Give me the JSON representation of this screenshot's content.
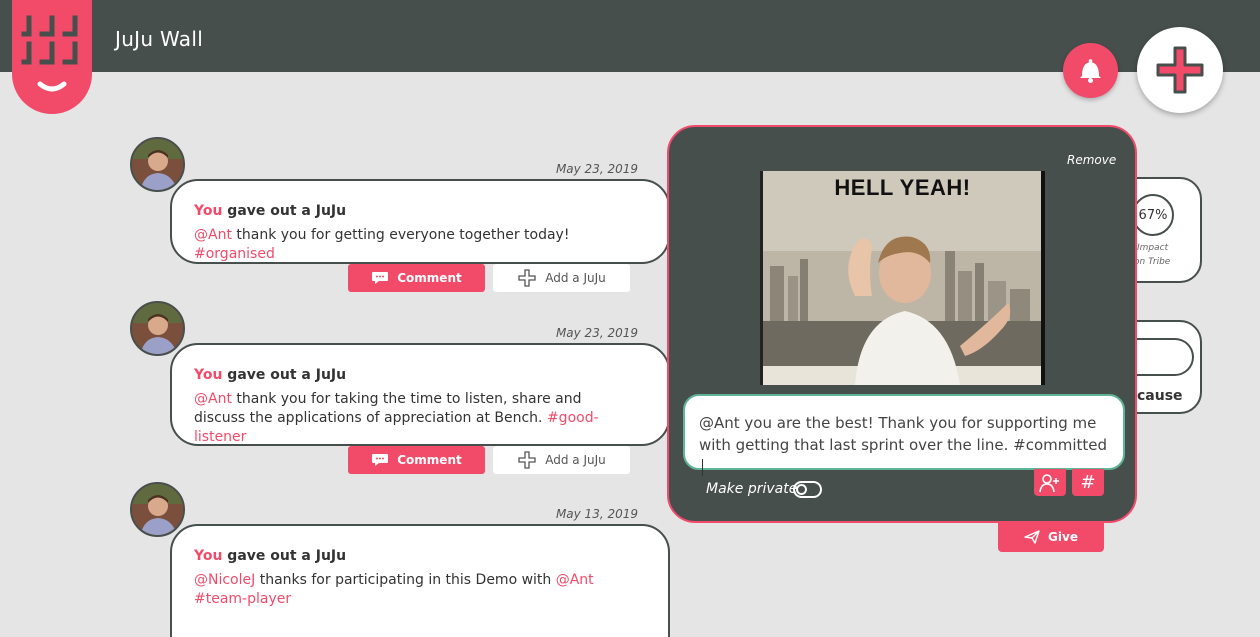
{
  "header": {
    "app_title": "JuJu Wall"
  },
  "colors": {
    "brand_pink": "#f24b6a",
    "topbar_dark": "#474f4d",
    "background": "#e5e5e5",
    "message_border_green": "#5fb597"
  },
  "icons": {
    "logo": "juju-logo-icon",
    "bell": "bell-icon",
    "plus": "plus-icon",
    "comment": "speech-bubble-icon",
    "add_juju": "plus-outline-icon",
    "add_user": "add-user-icon",
    "hashtag": "hashtag-icon",
    "give": "paper-plane-icon"
  },
  "feed": [
    {
      "date": "May 23, 2019",
      "actor": "You",
      "action": " gave out a JuJu",
      "mention": "@Ant",
      "text": " thank you for getting everyone together today! ",
      "tag": "#organised",
      "comment_label": "Comment",
      "add_juju_label": "Add a JuJu"
    },
    {
      "date": "May 23, 2019",
      "actor": "You",
      "action": " gave out a JuJu",
      "mention": "@Ant",
      "text": " thank you for taking the time to listen, share and discuss the applications of appreciation at Bench. ",
      "tag": "#good-listener",
      "comment_label": "Comment",
      "add_juju_label": "Add a JuJu"
    },
    {
      "date": "May 13, 2019",
      "actor": "You",
      "action": " gave out a JuJu",
      "mention": "@NicoleJ",
      "text": " thanks for participating in this Demo with ",
      "mention2": "@Ant",
      "tag": "#team-player"
    }
  ],
  "side_panel": {
    "percent": "67%",
    "impact_label": "Impact",
    "tribe_label": "on Tribe",
    "because_label": "cause"
  },
  "composer": {
    "remove_label": "Remove",
    "gif_caption": "HELL YEAH!",
    "message": "@Ant you are the best! Thank you for supporting me with getting that last sprint over the line. #committed",
    "hashtag_symbol": "#",
    "make_private_label": "Make private",
    "make_private_on": false,
    "give_label": "Give"
  }
}
